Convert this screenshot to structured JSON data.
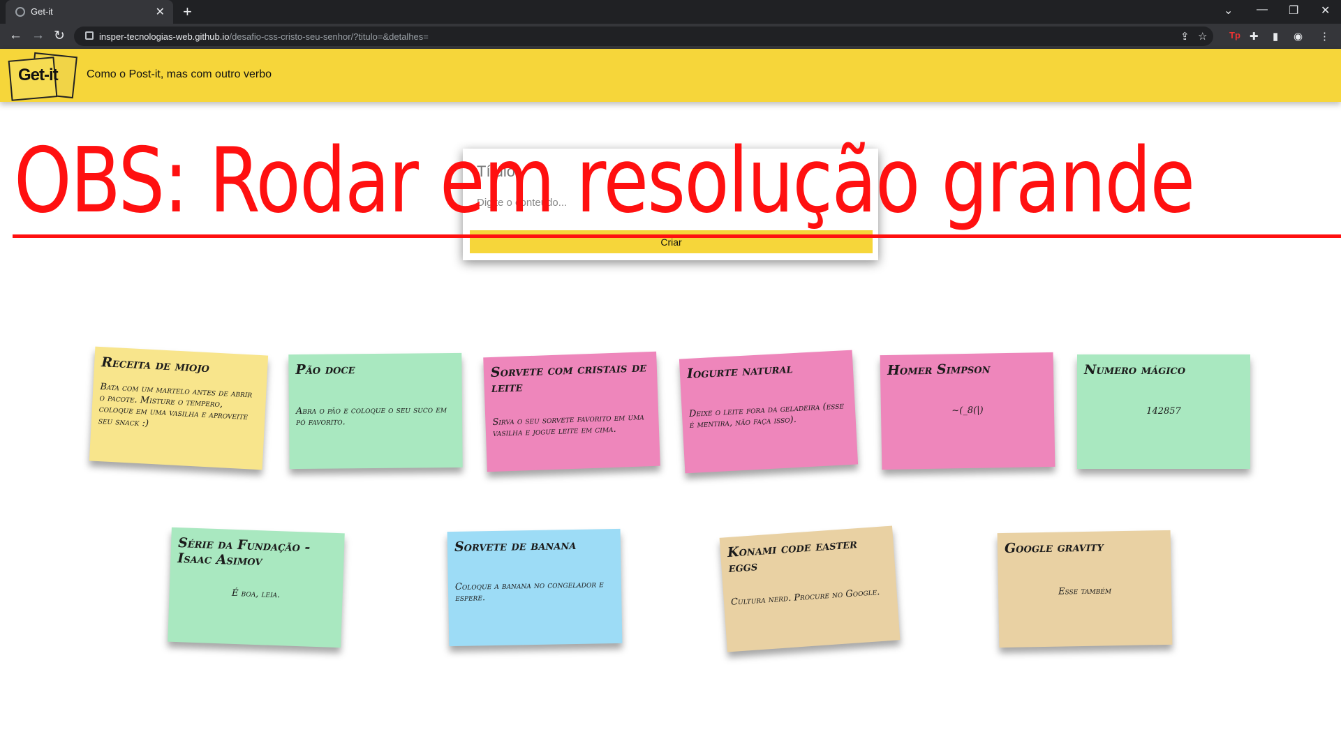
{
  "browser": {
    "tab_title": "Get-it",
    "url_host": "insper-tecnologias-web.github.io",
    "url_path": "/desafio-css-cristo-seu-senhor/?titulo=&detalhes="
  },
  "header": {
    "logo_text": "Get-it",
    "tagline": "Como o Post-it, mas com outro verbo"
  },
  "form": {
    "title_placeholder": "Título",
    "body_placeholder": "Digite o conteúdo...",
    "submit_label": "Criar"
  },
  "annotation": "OBS: Rodar em resolução grande",
  "notes": [
    {
      "title": "Receita de miojo",
      "body": "Bata com um martelo antes de abrir o pacote. Misture o tempero, coloque em uma vasilha e aproveite seu snack :)",
      "color": "#f8e58c"
    },
    {
      "title": "Pão doce",
      "body": "Abra o pão e coloque o seu suco em pó favorito.",
      "color": "#a9e8c0"
    },
    {
      "title": "Sorvete com cristais de leite",
      "body": "Sirva o seu sorvete favorito em uma vasilha e jogue leite em cima.",
      "color": "#ee86bb"
    },
    {
      "title": "Iogurte natural",
      "body": "Deixe o leite fora da geladeira (esse é mentira, não faça isso).",
      "color": "#ee86bb"
    },
    {
      "title": "Homer Simpson",
      "body": "~(_8(|)",
      "color": "#ee86bb"
    },
    {
      "title": "Numero mágico",
      "body": "142857",
      "color": "#a9e8c0"
    },
    {
      "title": "Série da Fundação - Isaac Asimov",
      "body": "É boa, leia.",
      "color": "#a9e8c0"
    },
    {
      "title": "Sorvete de banana",
      "body": "Coloque a banana no congelador e espere.",
      "color": "#9ddcf6"
    },
    {
      "title": "Konami code easter eggs",
      "body": "Cultura nerd. Procure no Google.",
      "color": "#e9d1a3"
    },
    {
      "title": "Google gravity",
      "body": "Esse também",
      "color": "#e9d1a3"
    }
  ]
}
